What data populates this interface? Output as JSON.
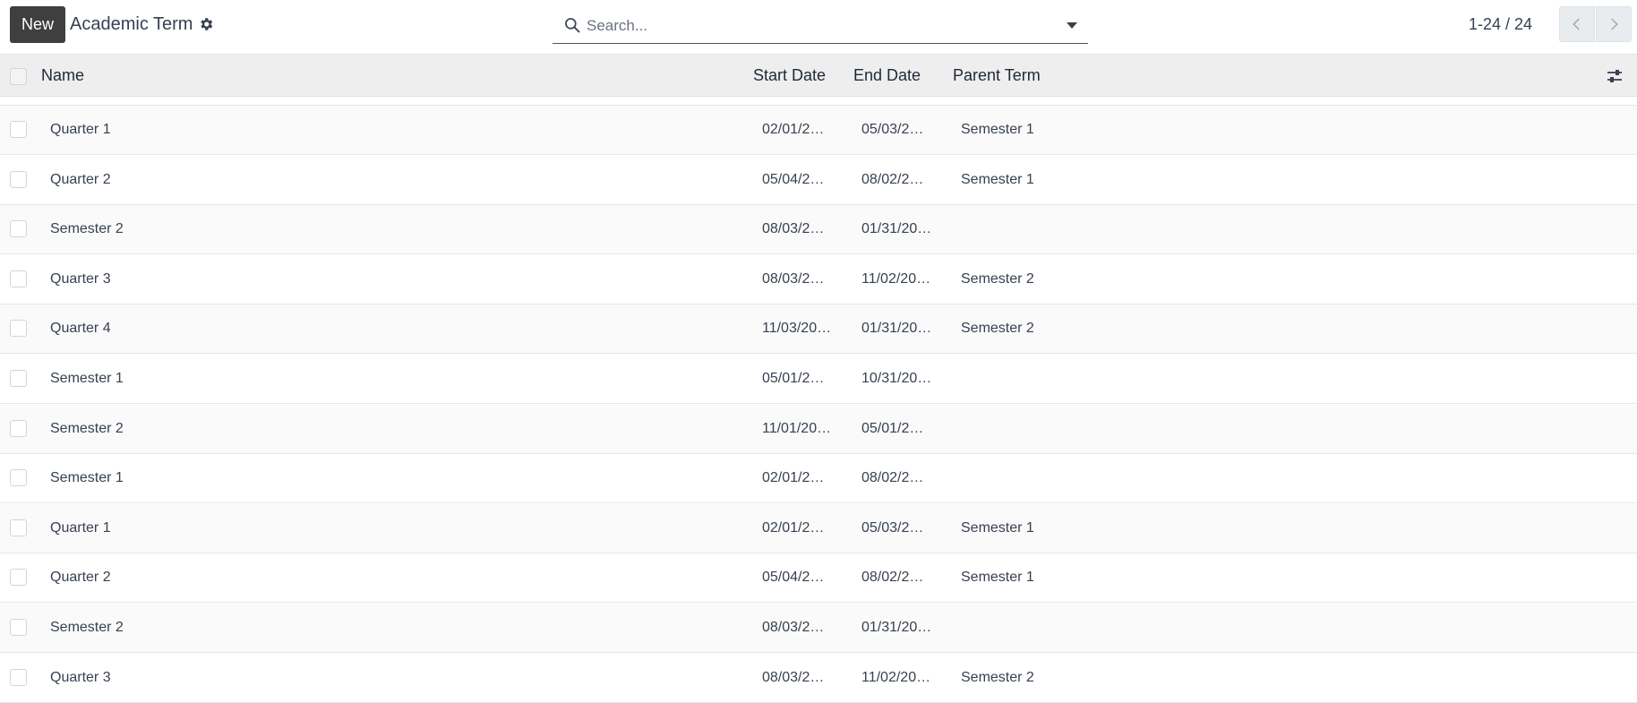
{
  "toolbar": {
    "new_label": "New",
    "title": "Academic Term"
  },
  "search": {
    "placeholder": "Search...",
    "value": ""
  },
  "pager": {
    "range": "1-24 / 24"
  },
  "table": {
    "columns": {
      "name": "Name",
      "start_date": "Start Date",
      "end_date": "End Date",
      "parent_term": "Parent Term"
    },
    "rows": [
      {
        "name": "Quarter 1",
        "start": "02/01/2…",
        "end": "05/03/2…",
        "parent": "Semester 1"
      },
      {
        "name": "Quarter 2",
        "start": "05/04/2…",
        "end": "08/02/2…",
        "parent": "Semester 1"
      },
      {
        "name": "Semester 2",
        "start": "08/03/2…",
        "end": "01/31/20…",
        "parent": ""
      },
      {
        "name": "Quarter 3",
        "start": "08/03/2…",
        "end": "11/02/20…",
        "parent": "Semester 2"
      },
      {
        "name": "Quarter 4",
        "start": "11/03/20…",
        "end": "01/31/20…",
        "parent": "Semester 2"
      },
      {
        "name": "Semester 1",
        "start": "05/01/2…",
        "end": "10/31/20…",
        "parent": ""
      },
      {
        "name": "Semester 2",
        "start": "11/01/20…",
        "end": "05/01/2…",
        "parent": ""
      },
      {
        "name": "Semester 1",
        "start": "02/01/2…",
        "end": "08/02/2…",
        "parent": ""
      },
      {
        "name": "Quarter 1",
        "start": "02/01/2…",
        "end": "05/03/2…",
        "parent": "Semester 1"
      },
      {
        "name": "Quarter 2",
        "start": "05/04/2…",
        "end": "08/02/2…",
        "parent": "Semester 1"
      },
      {
        "name": "Semester 2",
        "start": "08/03/2…",
        "end": "01/31/20…",
        "parent": ""
      },
      {
        "name": "Quarter 3",
        "start": "08/03/2…",
        "end": "11/02/20…",
        "parent": "Semester 2"
      }
    ]
  },
  "icons": {
    "gear": "gear-icon",
    "search": "search-icon",
    "dropdown": "caret-down-icon",
    "prev": "chevron-left-icon",
    "next": "chevron-right-icon",
    "settings": "sliders-icon"
  }
}
